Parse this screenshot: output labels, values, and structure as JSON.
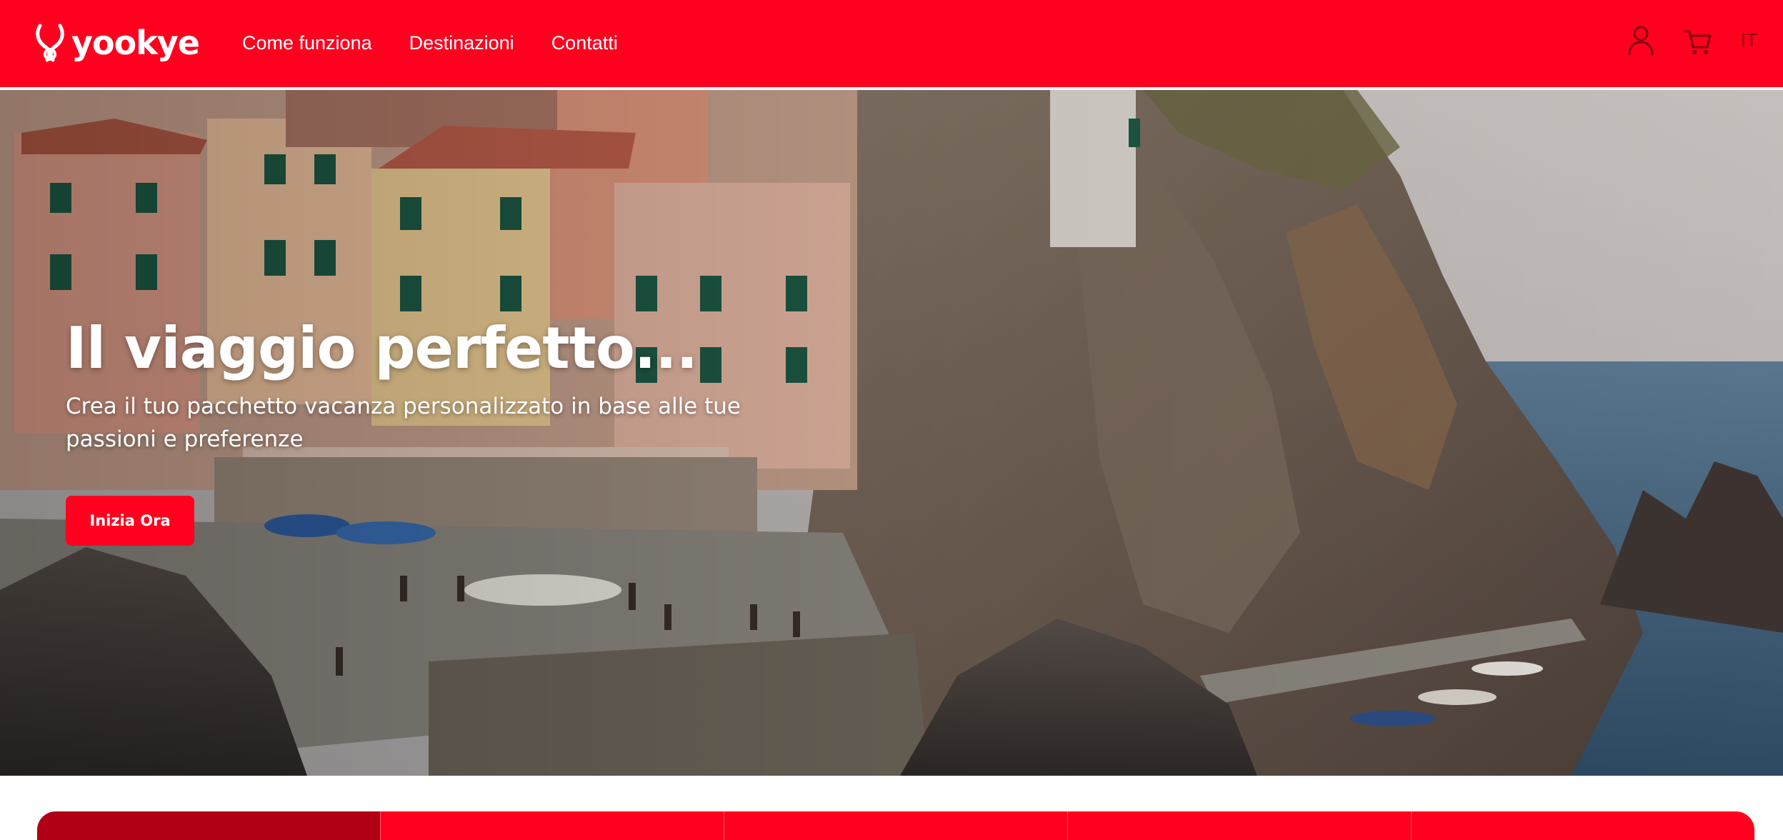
{
  "brand": {
    "name": "yookye",
    "color": "#ff001f"
  },
  "nav": {
    "items": [
      {
        "label": "Come funziona"
      },
      {
        "label": "Destinazioni"
      },
      {
        "label": "Contatti"
      }
    ]
  },
  "header": {
    "account_icon": "user-icon",
    "cart_icon": "cart-icon",
    "language": "IT"
  },
  "hero": {
    "title": "Il viaggio perfetto...",
    "subtitle": "Crea il tuo pacchetto vacanza personalizzato in base alle tue passioni e preferenze",
    "cta_label": "Inizia Ora",
    "image": "cliffside-village-by-the-sea"
  },
  "tabs": {
    "count": 5,
    "active_index": 0
  }
}
